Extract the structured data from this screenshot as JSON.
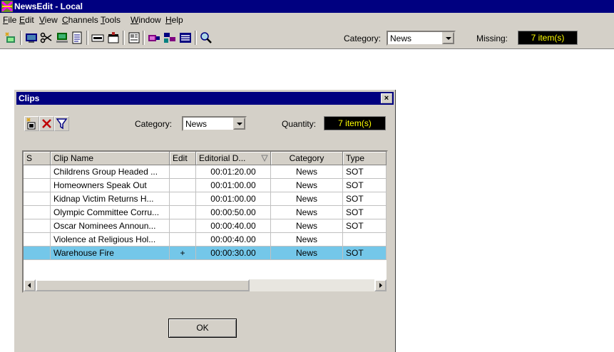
{
  "app": {
    "title": "NewsEdit - Local"
  },
  "menu": [
    "File",
    "Edit",
    "View",
    "Channels",
    "Tools",
    "Window",
    "Help"
  ],
  "toolbar": {
    "category_label": "Category:",
    "category_value": "News",
    "missing_label": "Missing:",
    "missing_value": "7 item(s)",
    "icons": [
      "new-clip-icon",
      "monitor-icon",
      "scissors-icon",
      "computer-icon",
      "document-icon",
      "strip-icon",
      "clapper-icon",
      "properties-icon",
      "channel-icon",
      "channels-icon",
      "list-icon",
      "search-icon"
    ]
  },
  "dialog": {
    "title": "Clips",
    "close_symbol": "×",
    "category_label": "Category:",
    "category_value": "News",
    "quantity_label": "Quantity:",
    "quantity_value": "7 item(s)",
    "ok_label": "OK",
    "icons": [
      "new-clip-icon",
      "delete-icon",
      "filter-icon"
    ]
  },
  "table": {
    "columns": [
      "S",
      "Clip Name",
      "Edit",
      "Editorial D...",
      "Category",
      "Type"
    ],
    "rows": [
      {
        "s": "",
        "name": "Childrens Group Headed ...",
        "edit": "",
        "dur": "00:01:20.00",
        "cat": "News",
        "type": "SOT"
      },
      {
        "s": "",
        "name": "Homeowners Speak Out",
        "edit": "",
        "dur": "00:01:00.00",
        "cat": "News",
        "type": "SOT"
      },
      {
        "s": "",
        "name": "Kidnap Victim Returns H...",
        "edit": "",
        "dur": "00:01:00.00",
        "cat": "News",
        "type": "SOT"
      },
      {
        "s": "",
        "name": "Olympic Committee Corru...",
        "edit": "",
        "dur": "00:00:50.00",
        "cat": "News",
        "type": "SOT"
      },
      {
        "s": "",
        "name": "Oscar Nominees Announ...",
        "edit": "",
        "dur": "00:00:40.00",
        "cat": "News",
        "type": "SOT"
      },
      {
        "s": "",
        "name": "Violence at Religious Hol...",
        "edit": "",
        "dur": "00:00:40.00",
        "cat": "News",
        "type": ""
      },
      {
        "s": "",
        "name": "Warehouse Fire",
        "edit": "+",
        "dur": "00:00:30.00",
        "cat": "News",
        "type": "SOT"
      }
    ],
    "selected_row": 6
  },
  "colors": {
    "titlebar": "#000080",
    "selection": "#74c7e9",
    "counter_bg": "#000000",
    "counter_text": "#ffff00",
    "face": "#d4d0c8"
  }
}
